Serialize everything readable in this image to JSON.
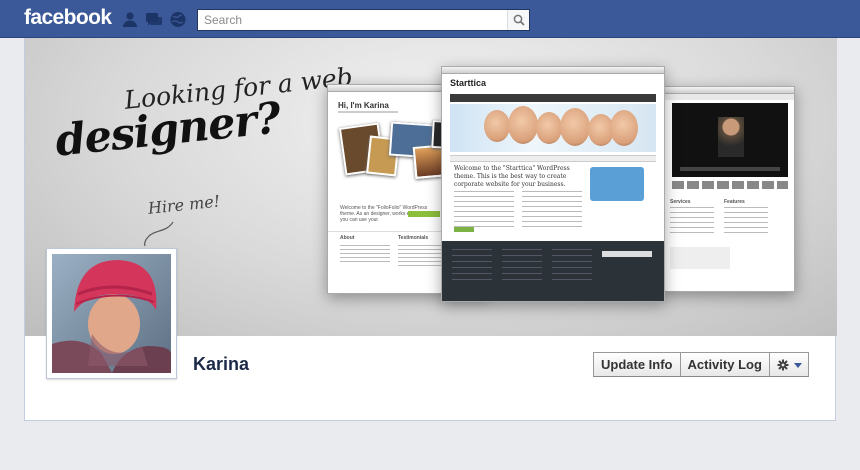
{
  "topbar": {
    "logo": "facebook",
    "icons": [
      "friend-requests-icon",
      "messages-icon",
      "notifications-icon"
    ],
    "search": {
      "placeholder": "Search",
      "value": ""
    }
  },
  "cover": {
    "line1": "Looking for a web",
    "line2": "designer?",
    "line3": "Hire me!",
    "left_shot": {
      "heading": "Hi, I'm Karina",
      "body": "Welcome to the \"FolioFolio\" WordPress theme. As an designer, works etc. As source you can use your",
      "about": "About",
      "testimonials": "Testimonials"
    },
    "center_shot": {
      "logo": "Starttica",
      "welcome": "Welcome to the \"Starttica\" WordPress theme. This is the best way to create corporate website for your business."
    },
    "right_shot": {
      "services": "Services",
      "features": "Features"
    }
  },
  "profile": {
    "name": "Karina",
    "buttons": {
      "update_info": "Update Info",
      "activity_log": "Activity Log"
    }
  },
  "colors": {
    "brand": "#3b5998",
    "name": "#1c2a47"
  }
}
